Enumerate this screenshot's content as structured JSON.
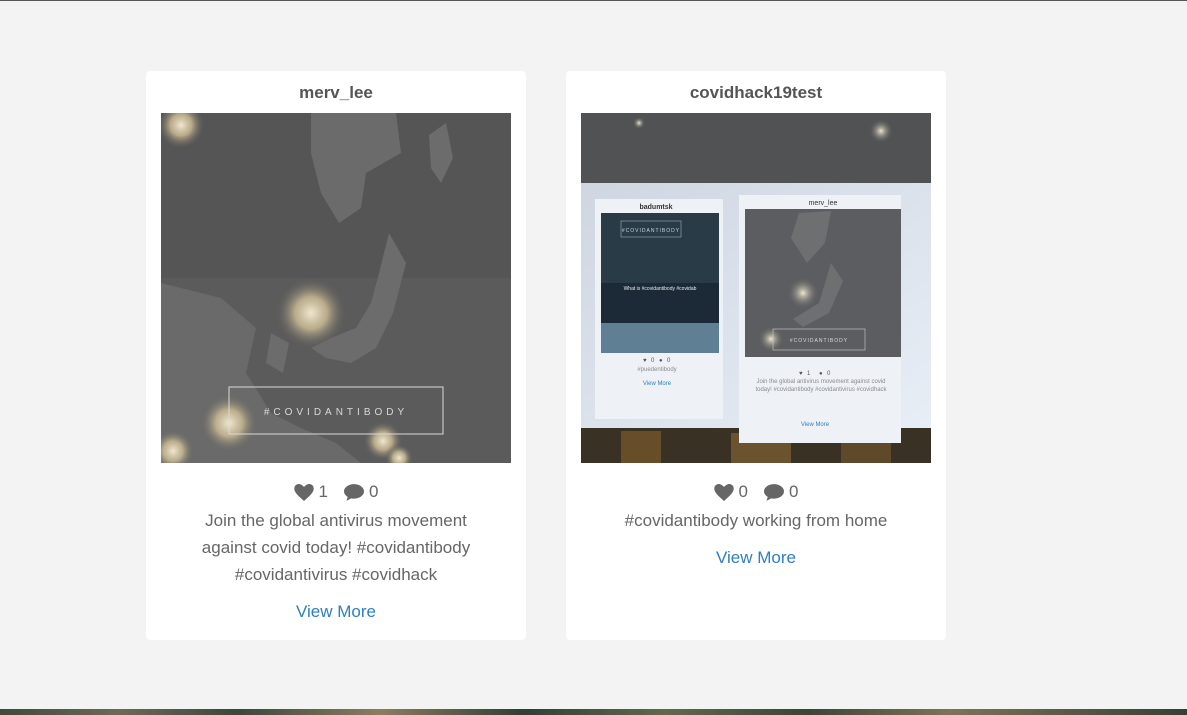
{
  "posts": [
    {
      "username": "merv_lee",
      "likes": "1",
      "comments": "0",
      "caption": "Join the global antivirus movement against covid today! #covidantibody #covidantivirus #covidhack",
      "view_more": "View More",
      "image_text": "#COVIDANTIBODY"
    },
    {
      "username": "covidhack19test",
      "likes": "0",
      "comments": "0",
      "caption": "#covidantibody working from home",
      "view_more": "View More",
      "image_text": {
        "left_user": "badumtsk",
        "left_banner": "#COVIDANTIBODY",
        "left_headline": "What is #covidantibody #covidab",
        "left_likes": "0",
        "left_comments": "0",
        "left_caption": "#puedentibody",
        "left_link": "View More",
        "right_user": "merv_lee",
        "right_banner": "#COVIDANTIBODY",
        "right_likes": "1",
        "right_comments": "0",
        "right_caption": "Join the global antivirus movement against covid today! #covidantibody #covidantivirus #covidhack",
        "right_link": "View More"
      }
    }
  ],
  "colors": {
    "background": "#f3f3f3",
    "card": "#ffffff",
    "link": "#2d7fbf",
    "text": "#666666"
  },
  "icons": [
    "heart-icon",
    "comment-icon"
  ]
}
